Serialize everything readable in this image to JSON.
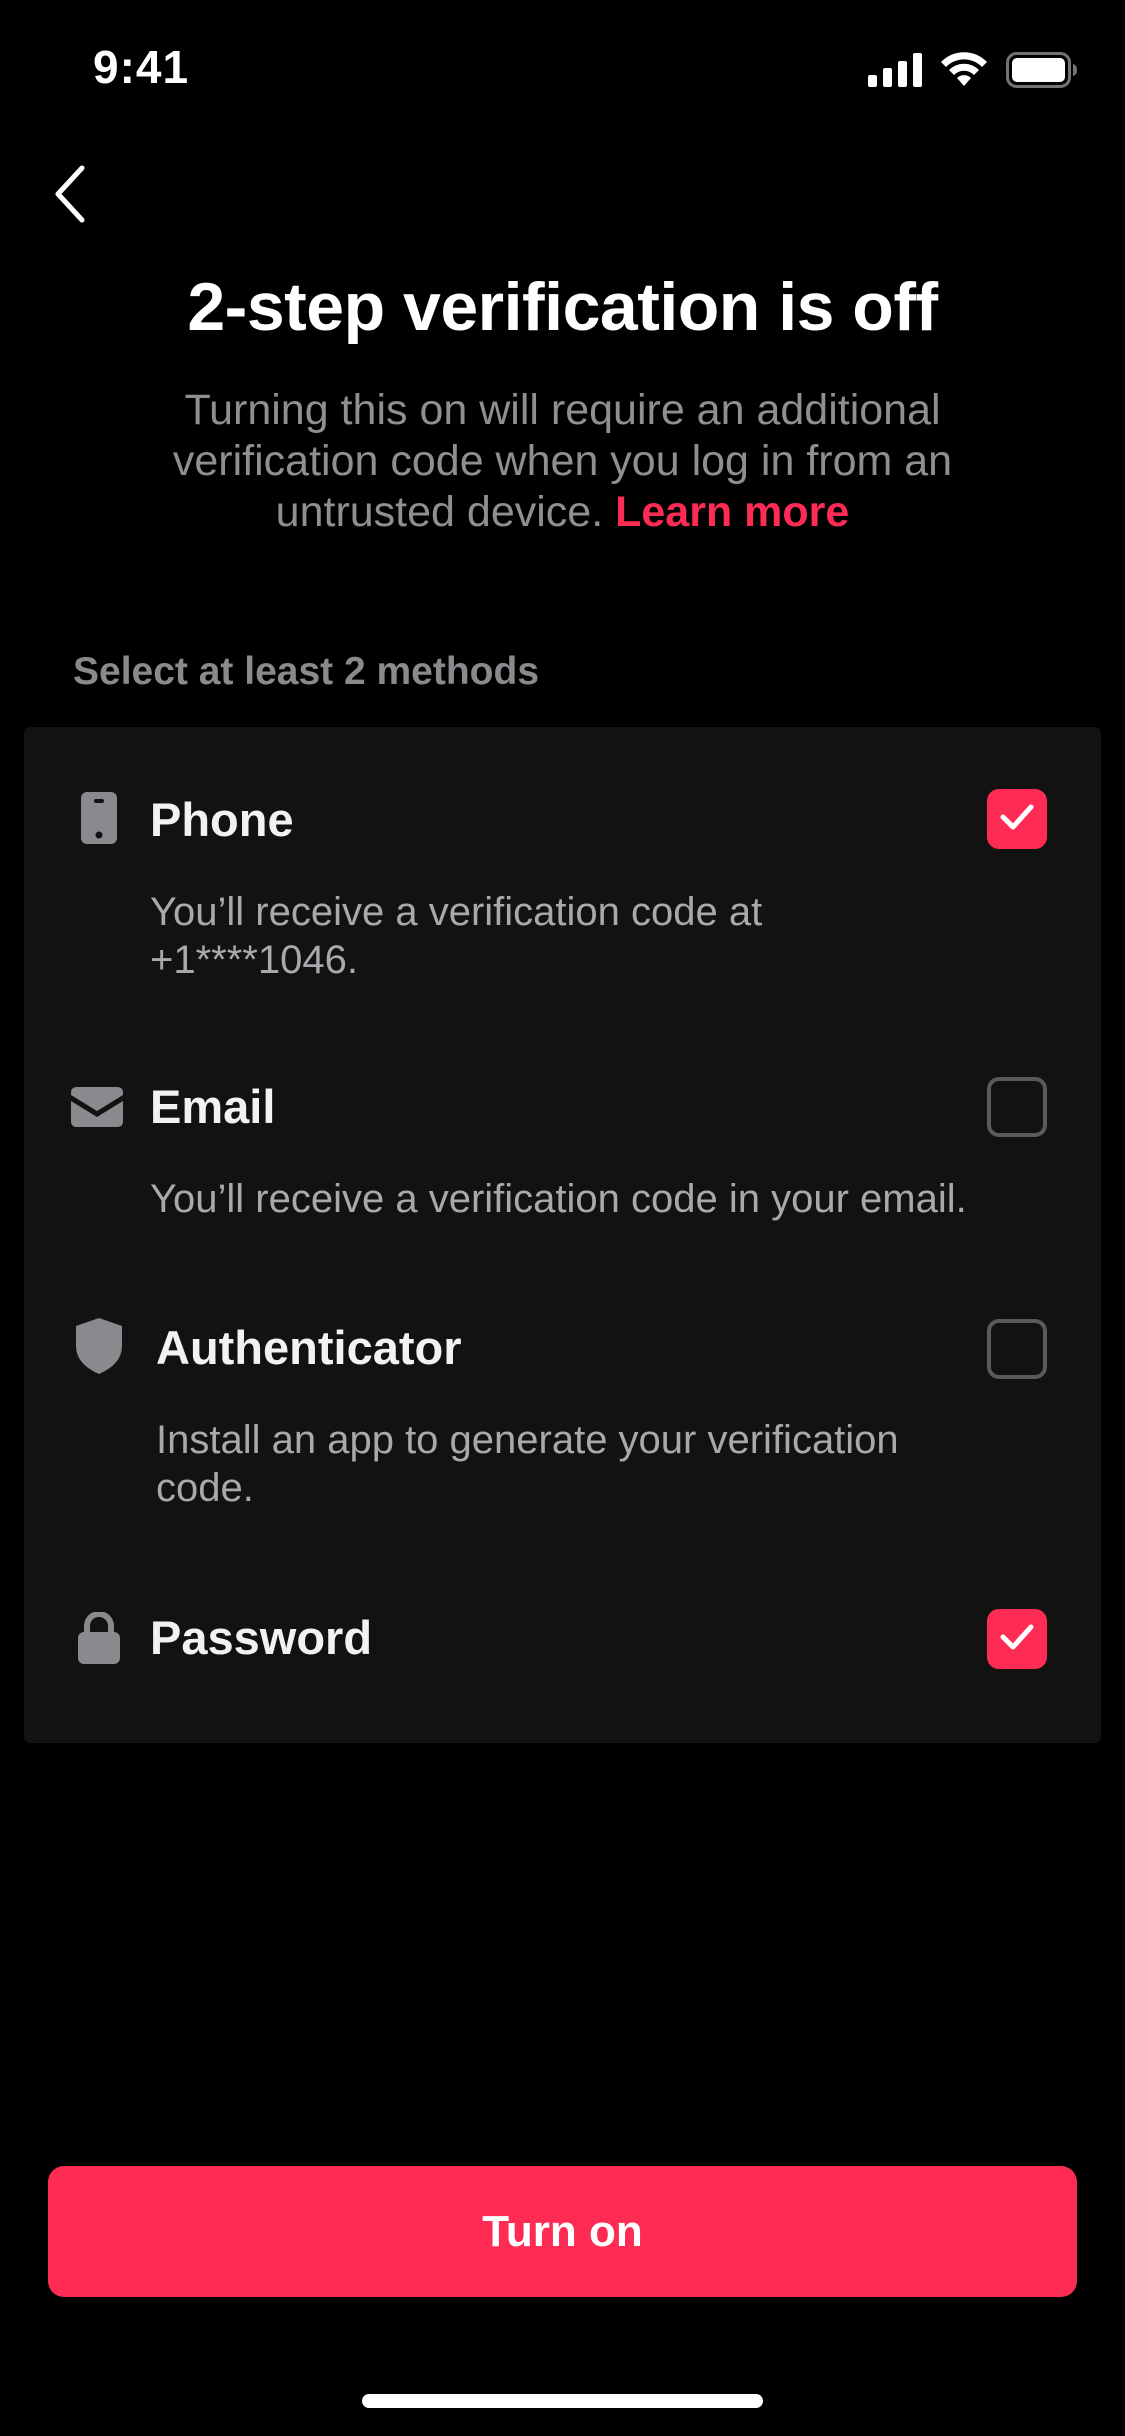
{
  "status_bar": {
    "time": "9:41",
    "icons": [
      "cellular-signal-icon",
      "wifi-icon",
      "battery-icon"
    ]
  },
  "nav": {
    "back_icon": "chevron-left-icon"
  },
  "header": {
    "title": "2-step verification is off",
    "description": "Turning this on will require an additional verification code when you log in from an untrusted device.",
    "learn_more": "Learn more"
  },
  "methods_section": {
    "label": "Select at least 2 methods",
    "methods": [
      {
        "name": "Phone",
        "description": "You’ll receive a verification code at +1****1046.",
        "icon": "phone-icon",
        "checked": true
      },
      {
        "name": "Email",
        "description": "You’ll receive a verification code in your email.",
        "icon": "envelope-icon",
        "checked": false
      },
      {
        "name": "Authenticator",
        "description": "Install an app to generate your verification code.",
        "icon": "shield-icon",
        "checked": false
      },
      {
        "name": "Password",
        "description": "",
        "icon": "lock-icon",
        "checked": true
      }
    ]
  },
  "actions": {
    "primary_label": "Turn on"
  },
  "colors": {
    "accent": "#fe2c55",
    "background": "#000000",
    "card": "#121212",
    "secondary_text": "#8f8f93"
  }
}
